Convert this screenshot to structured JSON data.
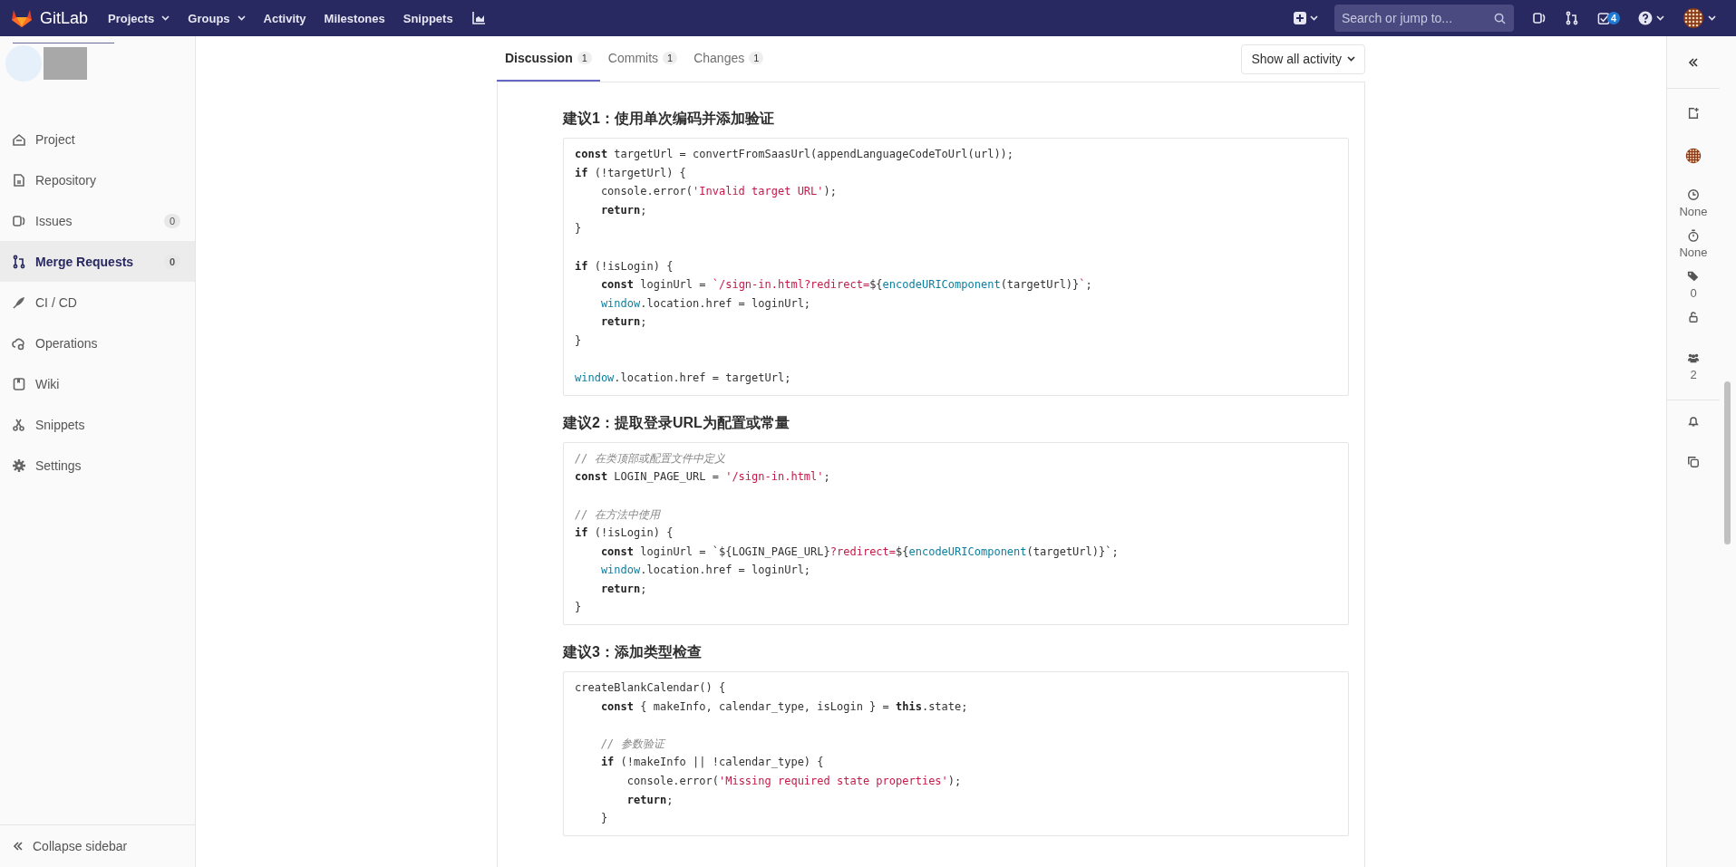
{
  "topbar": {
    "brand": "GitLab",
    "nav": [
      {
        "label": "Projects",
        "dropdown": true
      },
      {
        "label": "Groups",
        "dropdown": true
      },
      {
        "label": "Activity",
        "dropdown": false
      },
      {
        "label": "Milestones",
        "dropdown": false
      },
      {
        "label": "Snippets",
        "dropdown": false
      }
    ],
    "search": {
      "placeholder": "Search or jump to..."
    },
    "todo_count": "4"
  },
  "sidebar": {
    "items": [
      {
        "kind": "project",
        "label": "Project",
        "selected": false
      },
      {
        "kind": "repository",
        "label": "Repository",
        "selected": false
      },
      {
        "kind": "issues",
        "label": "Issues",
        "count": "0",
        "selected": false
      },
      {
        "kind": "merge",
        "label": "Merge Requests",
        "count": "0",
        "selected": true
      },
      {
        "kind": "cicd",
        "label": "CI / CD",
        "selected": false
      },
      {
        "kind": "operations",
        "label": "Operations",
        "selected": false
      },
      {
        "kind": "wiki",
        "label": "Wiki",
        "selected": false
      },
      {
        "kind": "snippets",
        "label": "Snippets",
        "selected": false
      },
      {
        "kind": "settings",
        "label": "Settings",
        "selected": false
      }
    ],
    "collapse": "Collapse sidebar"
  },
  "tabs": [
    {
      "label": "Discussion",
      "count": "1",
      "selected": true
    },
    {
      "label": "Commits",
      "count": "1",
      "selected": false
    },
    {
      "label": "Changes",
      "count": "1",
      "selected": false
    }
  ],
  "activity_filter": "Show all activity",
  "sections": [
    {
      "heading": "建议1：使用单次编码并添加验证",
      "lines": [
        {
          "kind": "code",
          "tokens": [
            {
              "kind": "kw",
              "text": "const"
            },
            {
              "kind": "plain",
              "text": " targetUrl = convertFromSaasUrl(appendLanguageCodeToUrl(url));"
            }
          ]
        },
        {
          "kind": "code",
          "tokens": [
            {
              "kind": "kw",
              "text": "if"
            },
            {
              "kind": "plain",
              "text": " (!targetUrl) {"
            }
          ]
        },
        {
          "kind": "code",
          "tokens": [
            {
              "kind": "plain",
              "text": "    console.error("
            },
            {
              "kind": "str",
              "text": "'Invalid target URL'"
            },
            {
              "kind": "plain",
              "text": ");"
            }
          ]
        },
        {
          "kind": "code",
          "tokens": [
            {
              "kind": "kw",
              "text": "    return"
            },
            {
              "kind": "plain",
              "text": ";"
            }
          ]
        },
        {
          "kind": "code",
          "tokens": [
            {
              "kind": "plain",
              "text": "}"
            }
          ]
        },
        {
          "kind": "blank"
        },
        {
          "kind": "code",
          "tokens": [
            {
              "kind": "kw",
              "text": "if"
            },
            {
              "kind": "plain",
              "text": " (!isLogin) {"
            }
          ]
        },
        {
          "kind": "code",
          "tokens": [
            {
              "kind": "kw",
              "text": "    const"
            },
            {
              "kind": "plain",
              "text": " loginUrl = "
            },
            {
              "kind": "str",
              "text": "`/sign-in.html?redirect="
            },
            {
              "kind": "plain",
              "text": "${"
            },
            {
              "kind": "fn",
              "text": "encodeURIComponent"
            },
            {
              "kind": "plain",
              "text": "(targetUrl)}"
            },
            {
              "kind": "str",
              "text": "`"
            },
            {
              "kind": "plain",
              "text": ";"
            }
          ]
        },
        {
          "kind": "code",
          "tokens": [
            {
              "kind": "fn",
              "text": "    window"
            },
            {
              "kind": "plain",
              "text": ".location.href = loginUrl;"
            }
          ]
        },
        {
          "kind": "code",
          "tokens": [
            {
              "kind": "kw",
              "text": "    return"
            },
            {
              "kind": "plain",
              "text": ";"
            }
          ]
        },
        {
          "kind": "code",
          "tokens": [
            {
              "kind": "plain",
              "text": "}"
            }
          ]
        },
        {
          "kind": "blank"
        },
        {
          "kind": "code",
          "tokens": [
            {
              "kind": "fn",
              "text": "window"
            },
            {
              "kind": "plain",
              "text": ".location.href = targetUrl;"
            }
          ]
        }
      ]
    },
    {
      "heading": "建议2：提取登录URL为配置或常量",
      "lines": [
        {
          "kind": "code",
          "tokens": [
            {
              "kind": "comment",
              "text": "// 在类顶部或配置文件中定义"
            }
          ]
        },
        {
          "kind": "code",
          "tokens": [
            {
              "kind": "kw",
              "text": "const"
            },
            {
              "kind": "plain",
              "text": " LOGIN_PAGE_URL = "
            },
            {
              "kind": "str",
              "text": "'/sign-in.html'"
            },
            {
              "kind": "plain",
              "text": ";"
            }
          ]
        },
        {
          "kind": "blank"
        },
        {
          "kind": "code",
          "tokens": [
            {
              "kind": "comment",
              "text": "// 在方法中使用"
            }
          ]
        },
        {
          "kind": "code",
          "tokens": [
            {
              "kind": "kw",
              "text": "if"
            },
            {
              "kind": "plain",
              "text": " (!isLogin) {"
            }
          ]
        },
        {
          "kind": "code",
          "tokens": [
            {
              "kind": "kw",
              "text": "    const"
            },
            {
              "kind": "plain",
              "text": " loginUrl = `${LOGIN_PAGE_URL}"
            },
            {
              "kind": "str",
              "text": "?redirect="
            },
            {
              "kind": "plain",
              "text": "${"
            },
            {
              "kind": "fn",
              "text": "encodeURIComponent"
            },
            {
              "kind": "plain",
              "text": "(targetUrl)}`;"
            }
          ]
        },
        {
          "kind": "code",
          "tokens": [
            {
              "kind": "fn",
              "text": "    window"
            },
            {
              "kind": "plain",
              "text": ".location.href = loginUrl;"
            }
          ]
        },
        {
          "kind": "code",
          "tokens": [
            {
              "kind": "kw",
              "text": "    return"
            },
            {
              "kind": "plain",
              "text": ";"
            }
          ]
        },
        {
          "kind": "code",
          "tokens": [
            {
              "kind": "plain",
              "text": "}"
            }
          ]
        }
      ]
    },
    {
      "heading": "建议3：添加类型检查",
      "lines": [
        {
          "kind": "code",
          "tokens": [
            {
              "kind": "plain",
              "text": "createBlankCalendar() {"
            }
          ]
        },
        {
          "kind": "code",
          "tokens": [
            {
              "kind": "kw",
              "text": "    const"
            },
            {
              "kind": "plain",
              "text": " { makeInfo, calendar_type, isLogin } = "
            },
            {
              "kind": "kw",
              "text": "this"
            },
            {
              "kind": "plain",
              "text": ".state;"
            }
          ]
        },
        {
          "kind": "blank"
        },
        {
          "kind": "code",
          "tokens": [
            {
              "kind": "comment",
              "text": "    // 参数验证"
            }
          ]
        },
        {
          "kind": "code",
          "tokens": [
            {
              "kind": "kw",
              "text": "    if"
            },
            {
              "kind": "plain",
              "text": " (!makeInfo || !calendar_type) {"
            }
          ]
        },
        {
          "kind": "code",
          "tokens": [
            {
              "kind": "plain",
              "text": "        console.error("
            },
            {
              "kind": "str",
              "text": "'Missing required state properties'"
            },
            {
              "kind": "plain",
              "text": ");"
            }
          ]
        },
        {
          "kind": "code",
          "tokens": [
            {
              "kind": "kw",
              "text": "        return"
            },
            {
              "kind": "plain",
              "text": ";"
            }
          ]
        },
        {
          "kind": "code",
          "tokens": [
            {
              "kind": "plain",
              "text": "    }"
            }
          ]
        }
      ]
    }
  ],
  "right_sidebar": {
    "items": [
      {
        "kind": "todo"
      },
      {
        "kind": "assignee"
      },
      {
        "kind": "milestone",
        "value": "None"
      },
      {
        "kind": "time",
        "value": "None"
      },
      {
        "kind": "labels",
        "value": "0"
      },
      {
        "kind": "lock"
      },
      {
        "kind": "participants",
        "value": "2"
      },
      {
        "kind": "notifications"
      },
      {
        "kind": "reference"
      }
    ]
  }
}
